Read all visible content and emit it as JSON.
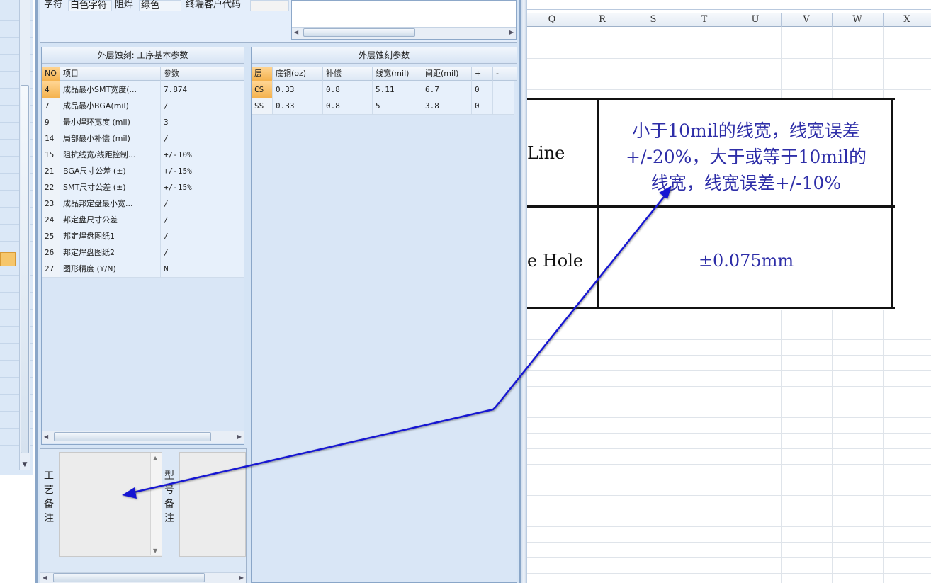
{
  "top": {
    "char_label": "字符",
    "char_value": "白色字符",
    "mask_label": "阻焊",
    "mask_value": "绿色",
    "customer_label": "终端客户代码"
  },
  "left_panel": {
    "title": "外层蚀刻: 工序基本参数",
    "headers": {
      "no": "NO",
      "item": "项目",
      "param": "参数"
    },
    "rows": [
      {
        "no": "4",
        "item": "成品最小SMT宽度(...",
        "param": "7.874"
      },
      {
        "no": "7",
        "item": "成品最小BGA(mil)",
        "param": "/"
      },
      {
        "no": "9",
        "item": "最小焊环宽度 (mil)",
        "param": "3"
      },
      {
        "no": "14",
        "item": "局部最小补偿 (mil)",
        "param": "/"
      },
      {
        "no": "15",
        "item": "阻抗线宽/线距控制...",
        "param": "+/-10%"
      },
      {
        "no": "21",
        "item": "BGA尺寸公差 (±)",
        "param": "+/-15%"
      },
      {
        "no": "22",
        "item": "SMT尺寸公差 (±)",
        "param": "+/-15%"
      },
      {
        "no": "23",
        "item": "成品邦定盘最小宽...",
        "param": "/"
      },
      {
        "no": "24",
        "item": "邦定盘尺寸公差",
        "param": "/"
      },
      {
        "no": "25",
        "item": "邦定焊盘图纸1",
        "param": "/"
      },
      {
        "no": "26",
        "item": "邦定焊盘图纸2",
        "param": "/"
      },
      {
        "no": "27",
        "item": "图形精度 (Y/N)",
        "param": "N"
      }
    ]
  },
  "right_panel": {
    "title": "外层蚀刻参数",
    "headers": {
      "layer": "层",
      "base_copper": "底铜(oz)",
      "compensation": "补偿",
      "line_width": "线宽(mil)",
      "spacing": "间距(mil)",
      "plus": "+",
      "minus": "-"
    },
    "rows": [
      {
        "layer": "CS",
        "base_copper": "0.33",
        "compensation": "0.8",
        "line_width": "5.11",
        "spacing": "6.7",
        "plus": "0",
        "minus": ""
      },
      {
        "layer": "SS",
        "base_copper": "0.33",
        "compensation": "0.8",
        "line_width": "5",
        "spacing": "3.8",
        "plus": "0",
        "minus": ""
      }
    ]
  },
  "notes": {
    "process_label": "工艺备注",
    "model_label": "型号备注"
  },
  "sheet": {
    "columns": [
      "Q",
      "R",
      "S",
      "T",
      "U",
      "V",
      "W",
      "X"
    ],
    "line_label": "Line",
    "line_value_1": "小于10mil的线宽，线宽误差",
    "line_value_2": "+/-20%，大于或等于10mil的",
    "line_value_3": "线宽，线宽误差+/-10%",
    "hole_label": "e Hole",
    "hole_value": "±0.075mm"
  },
  "colors": {
    "annotation_arrow": "#1414d2",
    "sheet_text": "#2e2ea8",
    "selection": "#f4b24e",
    "panel_bg": "#d9e6f6"
  }
}
